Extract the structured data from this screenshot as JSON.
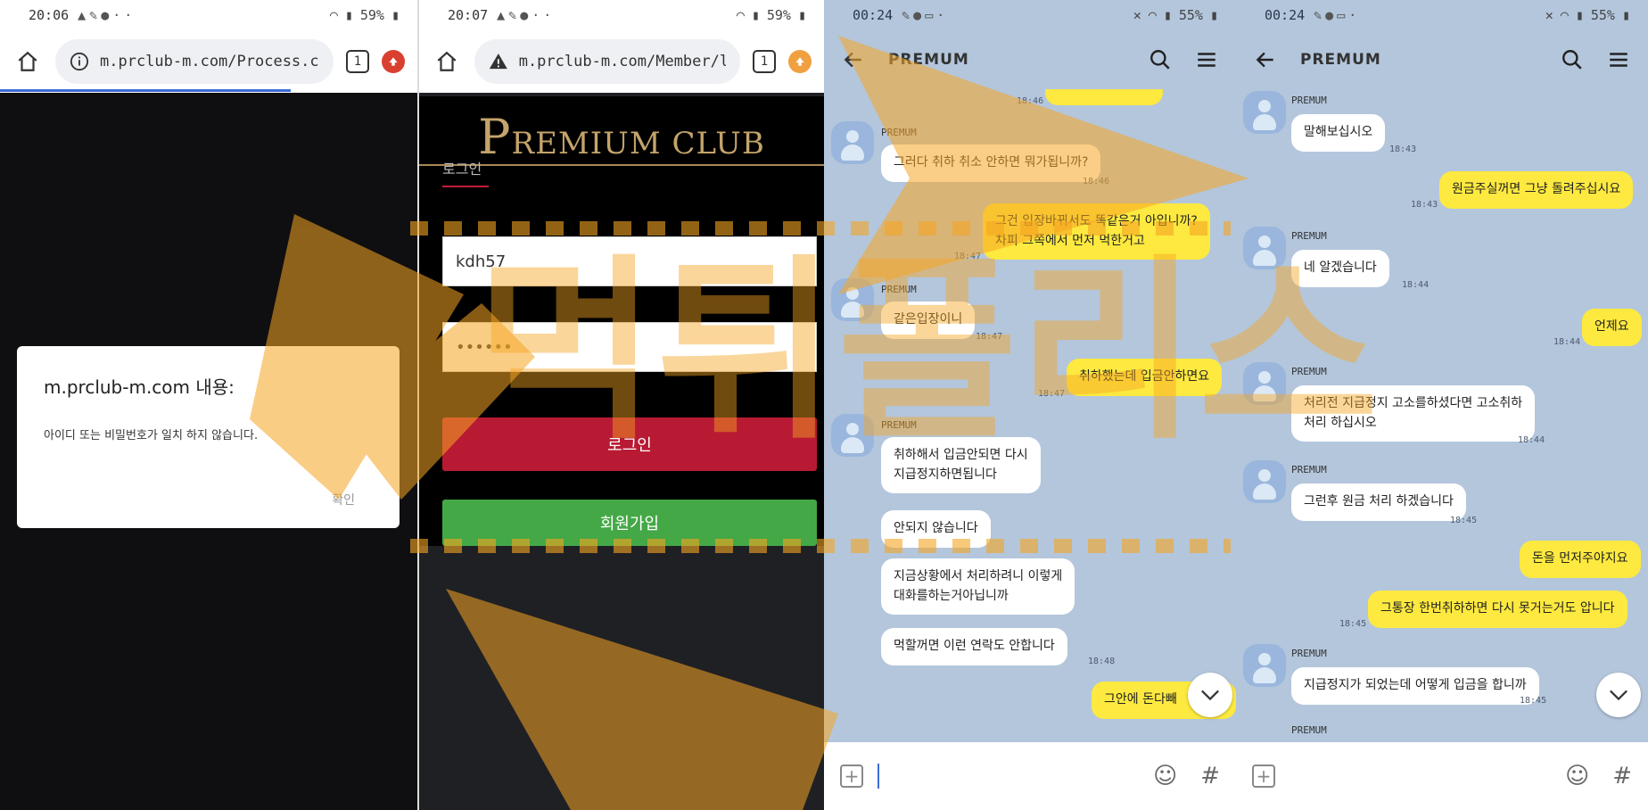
{
  "panel1": {
    "time": "20:06",
    "battery": "59%",
    "url": "m.prclub-m.com/Process.c",
    "dialog": {
      "title": "m.prclub-m.com 내용:",
      "message": "아이디 또는 비밀번호가 일치 하지 않습니다.",
      "ok_label": "확인"
    }
  },
  "panel2": {
    "time": "20:07",
    "battery": "59%",
    "url": "m.prclub-m.com/Member/l",
    "logo_initial": "P",
    "logo_rest": "REMIUM CLUB",
    "tab_label": "로그인",
    "id_value": "kdh57",
    "pw_value": "••••••",
    "login_label": "로그인",
    "join_label": "회원가입"
  },
  "panel3": {
    "time": "00:24",
    "battery": "55%",
    "chat_title": "PREMUM",
    "sender": "PREMUM",
    "messages": [
      {
        "side": "left",
        "text": "그러다 취하 취소 안하면 뭐가됩니까?",
        "time": "18:46"
      },
      {
        "side": "right",
        "text": "그건 입장바뀌서도 똑같은거 아입니까?",
        "text2": "차피 그쪽에서 먼저 먹한거고",
        "time": "18:47"
      },
      {
        "side": "left",
        "text": "같은입장이니",
        "time": "18:47"
      },
      {
        "side": "right",
        "text": "취하했는데 입금안하면요",
        "time": "18:47"
      },
      {
        "side": "left",
        "text": "취하해서 입금안되면 다시",
        "text2": "지급정지하면됩니다"
      },
      {
        "side": "left",
        "text": "안되지 않습니다"
      },
      {
        "side": "left",
        "text": "지금상황에서 처리하려니 이렇게",
        "text2": "대화를하는거아닙니까"
      },
      {
        "side": "left",
        "text": "먹할꺼면 이런 연락도 안합니다",
        "time": "18:48"
      },
      {
        "side": "right",
        "text": "그안에 돈다빼"
      }
    ],
    "top_time": "18:46"
  },
  "panel4": {
    "time": "00:24",
    "battery": "55%",
    "chat_title": "PREMUM",
    "sender": "PREMUM",
    "messages": [
      {
        "side": "left",
        "text": "말해보십시오",
        "time": "18:43"
      },
      {
        "side": "right",
        "text": "원금주실꺼면 그냥 돌려주십시요",
        "time": "18:43"
      },
      {
        "side": "left",
        "text": "네 알겠습니다",
        "time": "18:44"
      },
      {
        "side": "right",
        "text": "언제요",
        "time": "18:44"
      },
      {
        "side": "left",
        "text": "처리전 지급정지 고소를하셨다면 고소취하",
        "text2": "처리 하십시오",
        "time": "18:44"
      },
      {
        "side": "left",
        "text": "그런후 원금 처리 하겠습니다",
        "time": "18:45"
      },
      {
        "side": "right",
        "text": "돈을 먼저주야지요"
      },
      {
        "side": "right",
        "text": "그통장 한번취하하면 다시 못거는거도 압니다",
        "time": "18:45"
      },
      {
        "side": "left",
        "text": "지급정지가 되었는데 어떻게 입금을 합니까",
        "time": "18:45"
      }
    ]
  },
  "watermark": {
    "text": "먹튀폴리스",
    "color": "#f6a623"
  },
  "colors": {
    "yellow_bubble": "#fde93f",
    "chat_bg": "#b3c6dc",
    "login_red": "#b81a33",
    "join_green": "#44a846"
  }
}
